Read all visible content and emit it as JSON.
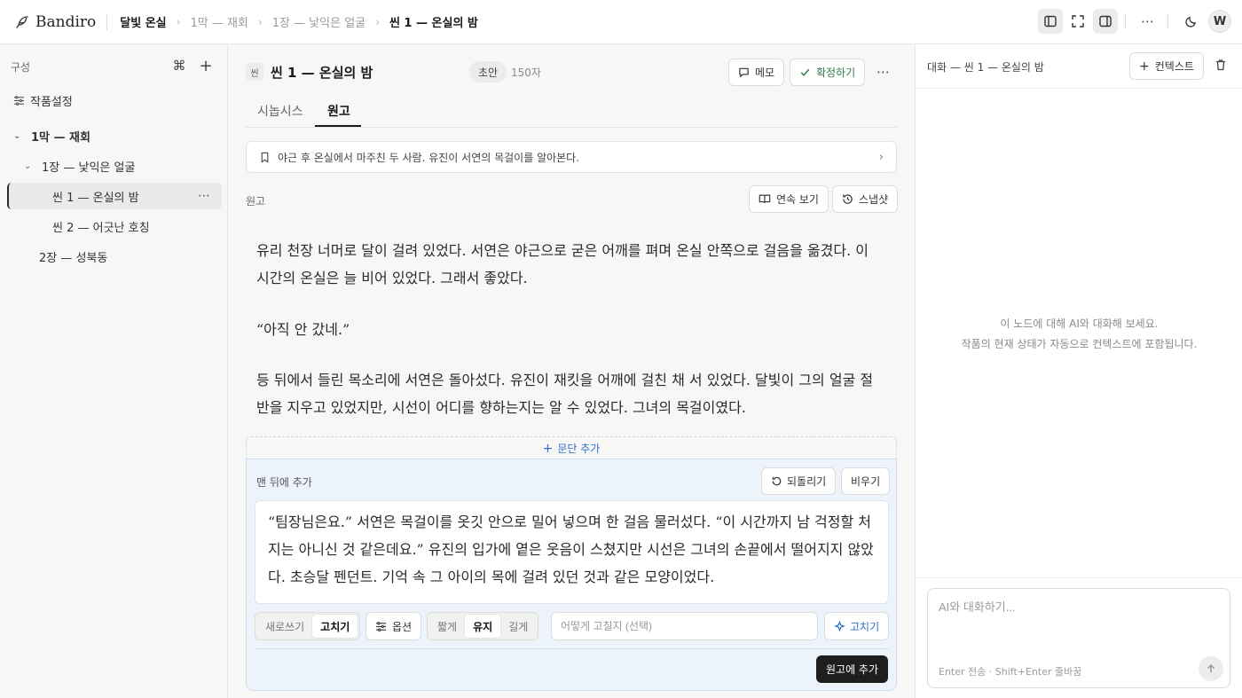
{
  "app": {
    "name": "Bandiro"
  },
  "breadcrumb": [
    "달빛 온실",
    "1막 — 재회",
    "1장 — 낯익은 얼굴",
    "씬 1 — 온실의 밤"
  ],
  "user": {
    "initial": "W"
  },
  "sidebar": {
    "heading": "구성",
    "items": [
      {
        "label": "작품설정"
      },
      {
        "label": "1막 — 재회"
      },
      {
        "label": "1장 — 낯익은 얼굴"
      },
      {
        "label": "씬 1 — 온실의 밤",
        "active": true
      },
      {
        "label": "씬 2 — 어긋난 호칭"
      },
      {
        "label": "2장 — 성북동"
      }
    ]
  },
  "scene": {
    "badge": "씬",
    "title": "씬 1 — 온실의 밤",
    "status": "초안",
    "char_count": "150자",
    "memo_label": "메모",
    "confirm_label": "확정하기"
  },
  "tabs": [
    {
      "label": "시놉시스"
    },
    {
      "label": "원고",
      "active": true
    }
  ],
  "summary": "야근 후 온실에서 마주친 두 사람. 유진이 서연의 목걸이를 알아본다.",
  "manuscript": {
    "label": "원고",
    "continuous_label": "연속 보기",
    "snapshot_label": "스냅샷",
    "paragraphs": [
      "유리 천장 너머로 달이 걸려 있었다. 서연은 야근으로 굳은 어깨를 펴며 온실 안쪽으로 걸음을 옮겼다. 이 시간의 온실은 늘 비어 있었다. 그래서 좋았다.",
      "“아직 안 갔네.”",
      "등 뒤에서 들린 목소리에 서연은 돌아섰다. 유진이 재킷을 어깨에 걸친 채 서 있었다. 달빛이 그의 얼굴 절반을 지우고 있었지만, 시선이 어디를 향하는지는 알 수 있었다. 그녀의 목걸이였다."
    ]
  },
  "editor": {
    "add_paragraph": "문단 추가",
    "position_label": "맨 뒤에 추가",
    "revert_label": "되돌리기",
    "clear_label": "비우기",
    "draft": "“팀장님은요.” 서연은 목걸이를 옷깃 안으로 밀어 넣으며 한 걸음 물러섰다. “이 시간까지 남 걱정할 처지는 아니신 것 같은데요.” 유진의 입가에 옅은 웃음이 스쳤지만 시선은 그녀의 손끝에서 떨어지지 않았다. 초승달 펜던트. 기억 속 그 아이의 목에 걸려 있던 것과 같은 모양이었다.",
    "mode": [
      {
        "label": "새로쓰기"
      },
      {
        "label": "고치기",
        "selected": true
      }
    ],
    "options_label": "옵션",
    "length": [
      {
        "label": "짧게"
      },
      {
        "label": "유지",
        "selected": true
      },
      {
        "label": "길게"
      }
    ],
    "hint_placeholder": "어떻게 고칠지 (선택)",
    "fix_label": "고치기",
    "add_to_manuscript": "원고에 추가"
  },
  "chat": {
    "title": "대화 — 씬 1 — 온실의 밤",
    "context_label": "컨텍스트",
    "empty_line1": "이 노드에 대해 AI와 대화해 보세요.",
    "empty_line2": "작품의 현재 상태가 자동으로 컨텍스트에 포함됩니다.",
    "input_placeholder": "AI와 대화하기...",
    "hint": "Enter 전송 · Shift+Enter 줄바꿈"
  },
  "colors": {
    "accent": "#2f6fcc",
    "confirm": "#2f7a4a",
    "editor_bg": "#edf3fb",
    "primary_dark": "#1e1e1e"
  }
}
